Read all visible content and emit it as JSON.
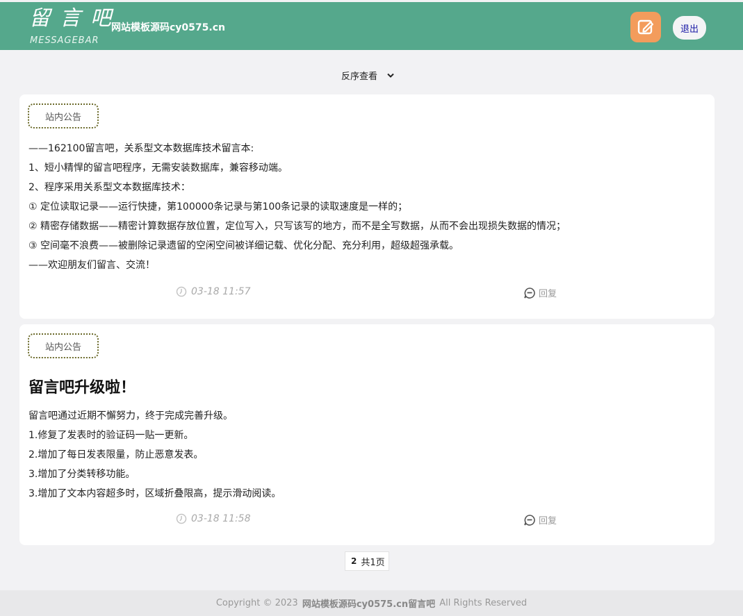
{
  "header": {
    "logo_main": "留言吧",
    "logo_sub": "MESSAGEBAR",
    "site_name": "网站模板源码cy0575.cn",
    "write_icon": "edit-icon",
    "logout_label": "退出",
    "colors": {
      "bar": "#55a88c",
      "write_button": "#f39c5c"
    }
  },
  "sort": {
    "label": "反序查看"
  },
  "posts": [
    {
      "tag": "站内公告",
      "lines": [
        "——162100留言吧，关系型文本数据库技术留言本:",
        "1、短小精悍的留言吧程序，无需安装数据库，兼容移动端。",
        "2、程序采用关系型文本数据库技术：",
        "① 定位读取记录——运行快捷，第100000条记录与第100条记录的读取速度是一样的；",
        "② 精密存储数据——精密计算数据存放位置，定位写入，只写该写的地方，而不是全写数据，从而不会出现损失数据的情况；",
        "③ 空间毫不浪费——被删除记录遗留的空闲空间被详细记载、优化分配、充分利用，超级超强承载。",
        "——欢迎朋友们留言、交流！"
      ],
      "time": "03-18 11:57",
      "reply": "回复"
    },
    {
      "tag": "站内公告",
      "title": "留言吧升级啦！",
      "lines": [
        "留言吧通过近期不懈努力，终于完成完善升级。",
        "1.修复了发表时的验证码一贴一更新。",
        "2.增加了每日发表限量，防止恶意发表。",
        "3.增加了分类转移功能。",
        "3.增加了文本内容超多时，区域折叠限高，提示滑动阅读。"
      ],
      "time": "03-18 11:58",
      "reply": "回复"
    }
  ],
  "pager": {
    "current": "2",
    "total": "共1页"
  },
  "footer": {
    "prefix": "Copyright © 2023",
    "brand": "网站模板源码cy0575.cn留言吧",
    "suffix": "All Rights Reserved"
  }
}
